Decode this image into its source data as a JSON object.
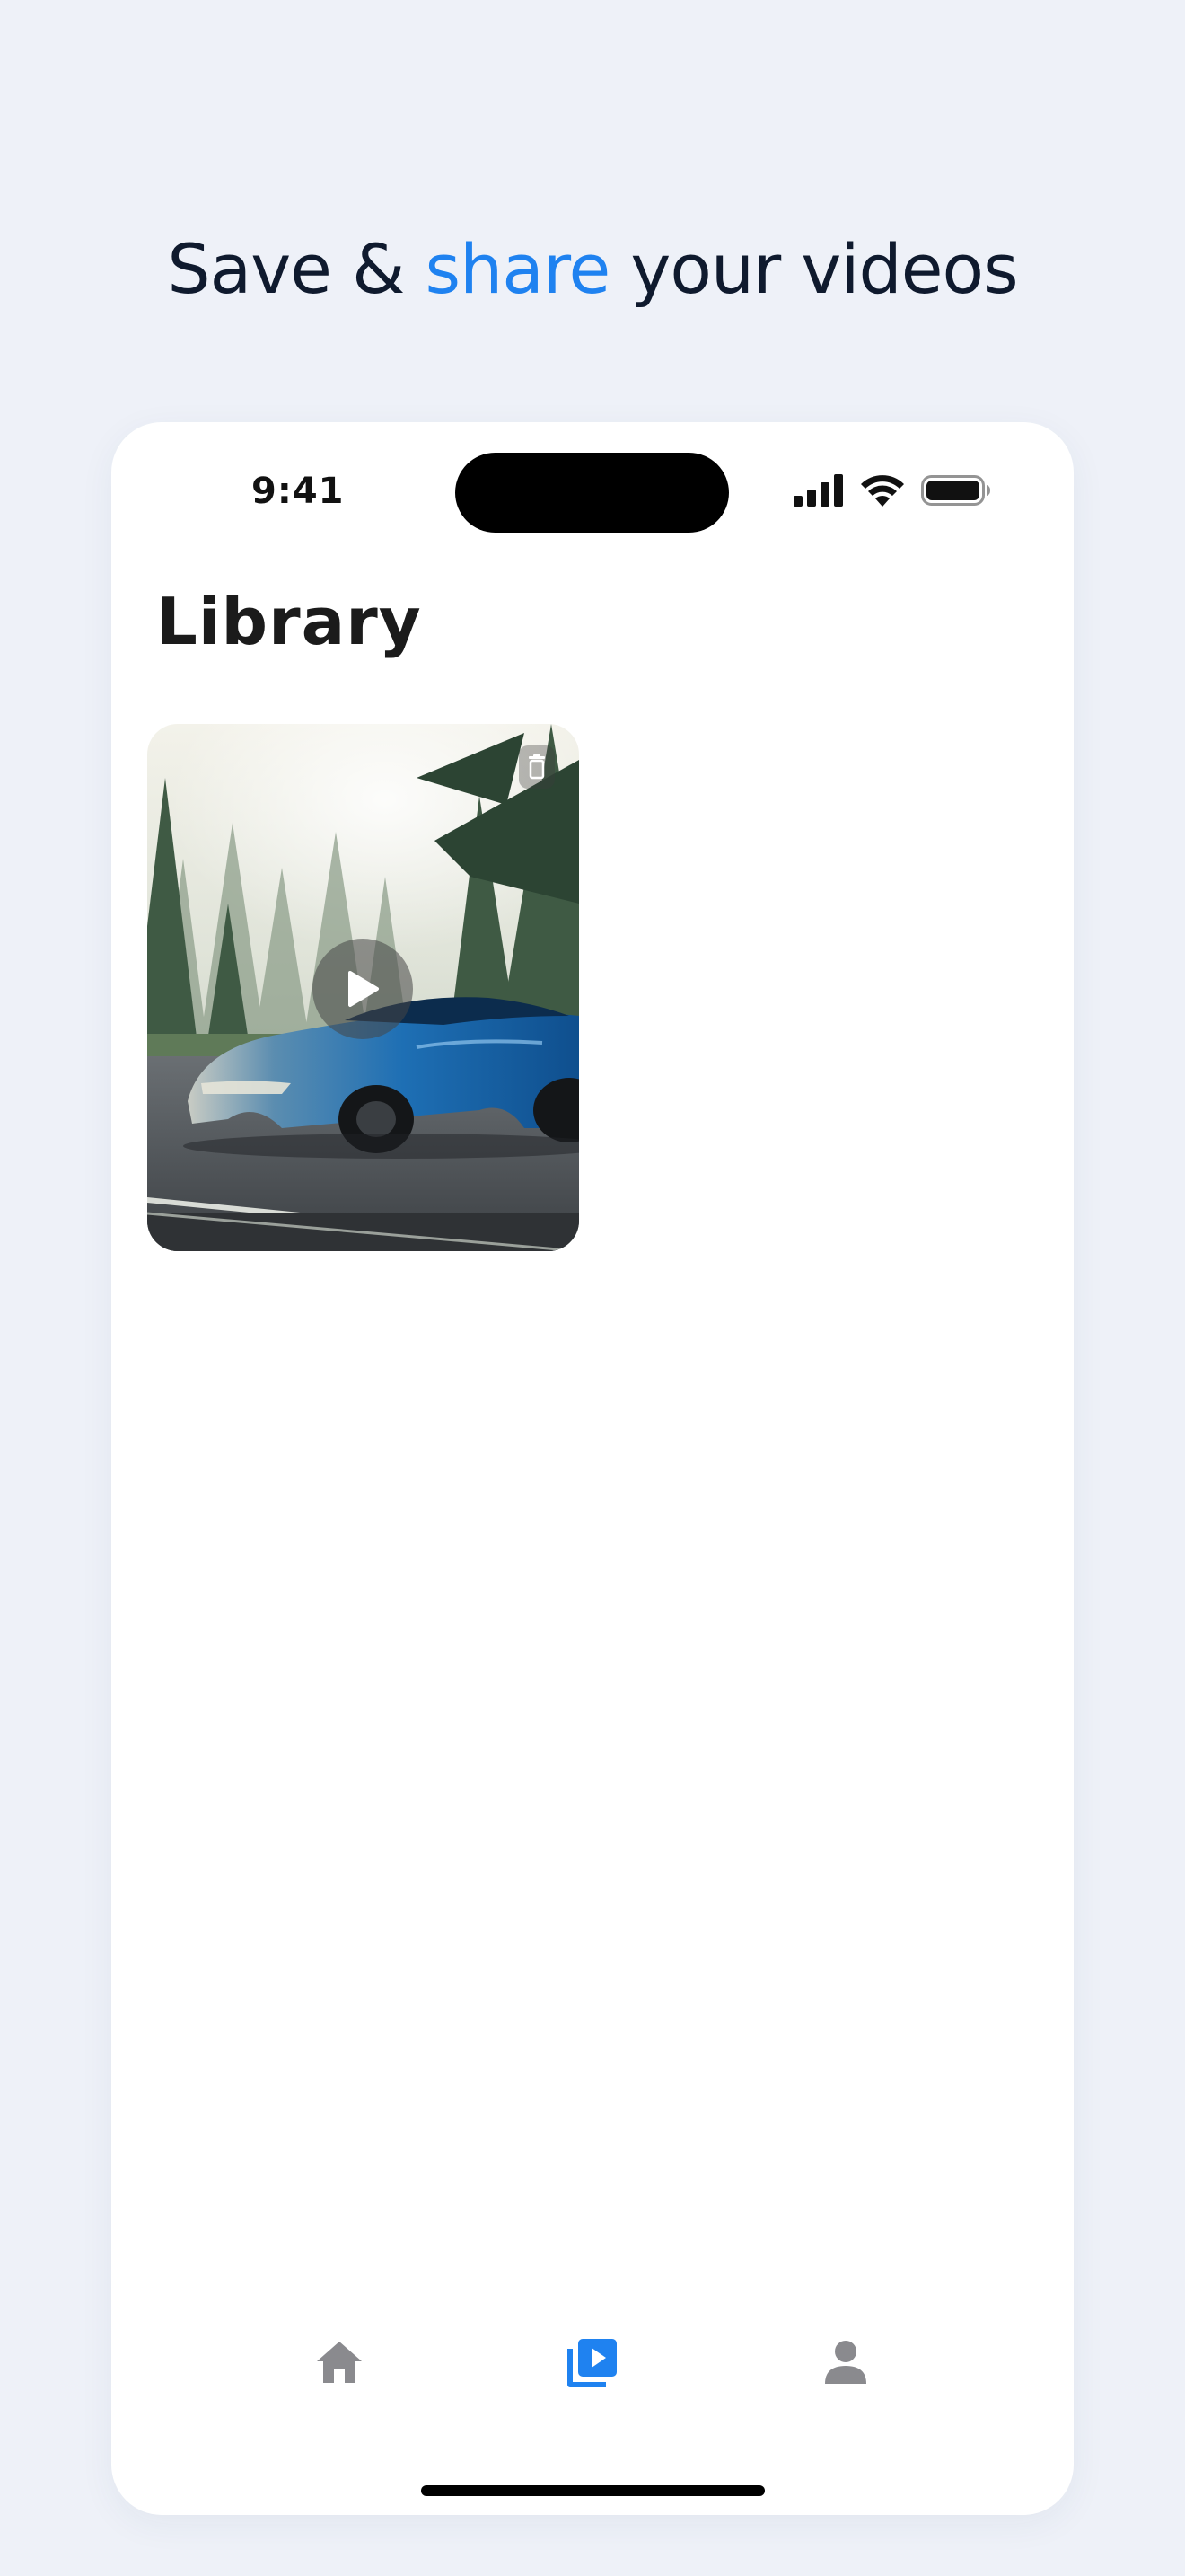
{
  "headline": {
    "part1": "Save & ",
    "accent": "share",
    "part2": " your videos"
  },
  "status_bar": {
    "time": "9:41",
    "icons": [
      "cellular-signal-icon",
      "wifi-icon",
      "battery-icon"
    ]
  },
  "library": {
    "title": "Library",
    "videos": [
      {
        "thumbnail": "blue sports car on road with pine forest",
        "actions": [
          "delete-icon",
          "play-icon"
        ]
      }
    ]
  },
  "tab_bar": {
    "tabs": [
      {
        "icon": "home-icon",
        "active": false
      },
      {
        "icon": "video-library-icon",
        "active": true
      },
      {
        "icon": "profile-icon",
        "active": false
      }
    ],
    "active_color": "#1f82f0",
    "inactive_color": "#8a8a8e"
  },
  "colors": {
    "background": "#eef1f8",
    "accent": "#1f82f0",
    "headline": "#0f1a2e"
  }
}
